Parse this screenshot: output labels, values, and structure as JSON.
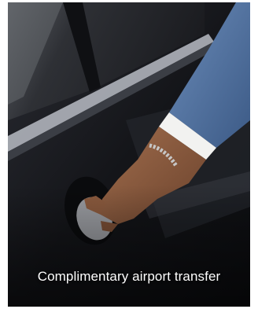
{
  "card": {
    "caption": "Complimentary airport transfer",
    "image_subject": "hand-opening-car-door-photo"
  },
  "colors": {
    "caption_text": "#ffffff",
    "car_body": "#16171c",
    "sleeve_blue": "#4e6f9c",
    "shirt_cuff": "#f2f2f0",
    "skin": "#8a5a3e",
    "window_glass": "#2b2d32"
  }
}
